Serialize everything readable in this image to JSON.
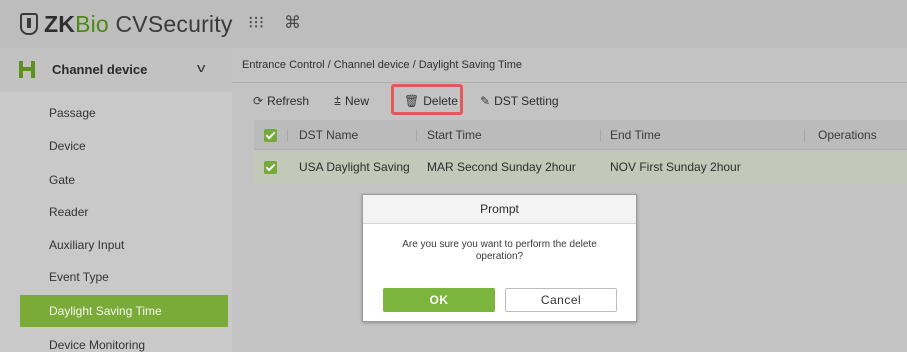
{
  "app": {
    "logo_zk": "ZK",
    "logo_bio": "Bio",
    "logo_cv": " CVSecurity",
    "menu_icon": "grid-dots-icon",
    "command_icon": "command-icon",
    "menu_glyph": "⁝⁝⁝",
    "command_glyph": "⌘"
  },
  "sidebar": {
    "module_label": "Channel device",
    "module_icon": "channel-device-icon",
    "items": [
      {
        "label": "Passage"
      },
      {
        "label": "Device"
      },
      {
        "label": "Gate"
      },
      {
        "label": "Reader"
      },
      {
        "label": "Auxiliary Input"
      },
      {
        "label": "Event Type"
      },
      {
        "label": "Daylight Saving Time",
        "active": true
      },
      {
        "label": "Device Monitoring"
      }
    ]
  },
  "breadcrumb": "Entrance Control / Channel device / Daylight Saving Time",
  "toolbar": {
    "refresh": "Refresh",
    "new": "New",
    "delete": "Delete",
    "dst_setting": "DST Setting"
  },
  "table": {
    "columns": [
      "DST Name",
      "Start Time",
      "End Time",
      "Operations"
    ],
    "rows": [
      {
        "dst_name": "USA Daylight Saving",
        "start_time": "MAR Second Sunday 2hour",
        "end_time": "NOV First Sunday 2hour",
        "operations": ""
      }
    ]
  },
  "dialog": {
    "title": "Prompt",
    "message": "Are you sure you want to perform the delete operation?",
    "ok": "OK",
    "cancel": "Cancel"
  },
  "colors": {
    "accent": "#7aab38",
    "highlight": "#e05a5c"
  }
}
